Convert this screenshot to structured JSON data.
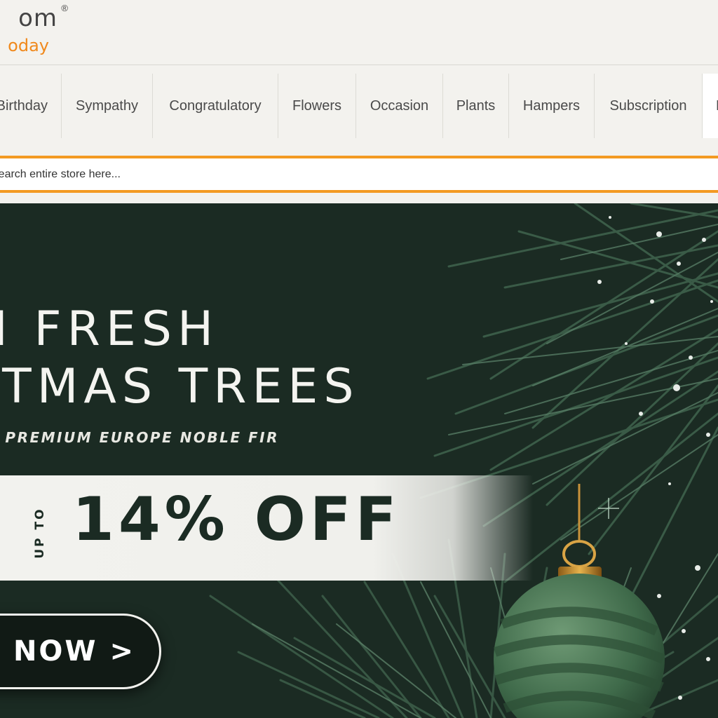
{
  "logo": {
    "line1": "om",
    "registered": "®",
    "line2": "oday",
    "accent_color": "#f0891c"
  },
  "nav": {
    "items": [
      {
        "label": "Birthday"
      },
      {
        "label": "Sympathy"
      },
      {
        "label": "Congratulatory"
      },
      {
        "label": "Flowers"
      },
      {
        "label": "Occasion"
      },
      {
        "label": "Plants"
      },
      {
        "label": "Hampers"
      },
      {
        "label": "Subscription"
      },
      {
        "label": "E"
      }
    ]
  },
  "search": {
    "placeholder": "Search entire store here...",
    "border_color": "#f39a22"
  },
  "banner": {
    "title_line1": "N FRESH",
    "title_line2": "STMAS TREES",
    "subtitle": "& PREMIUM EUROPE NOBLE FIR",
    "offer_prefix": "UP TO",
    "offer": "14% OFF",
    "cta": "R NOW >",
    "background_color": "#1b2b23"
  }
}
